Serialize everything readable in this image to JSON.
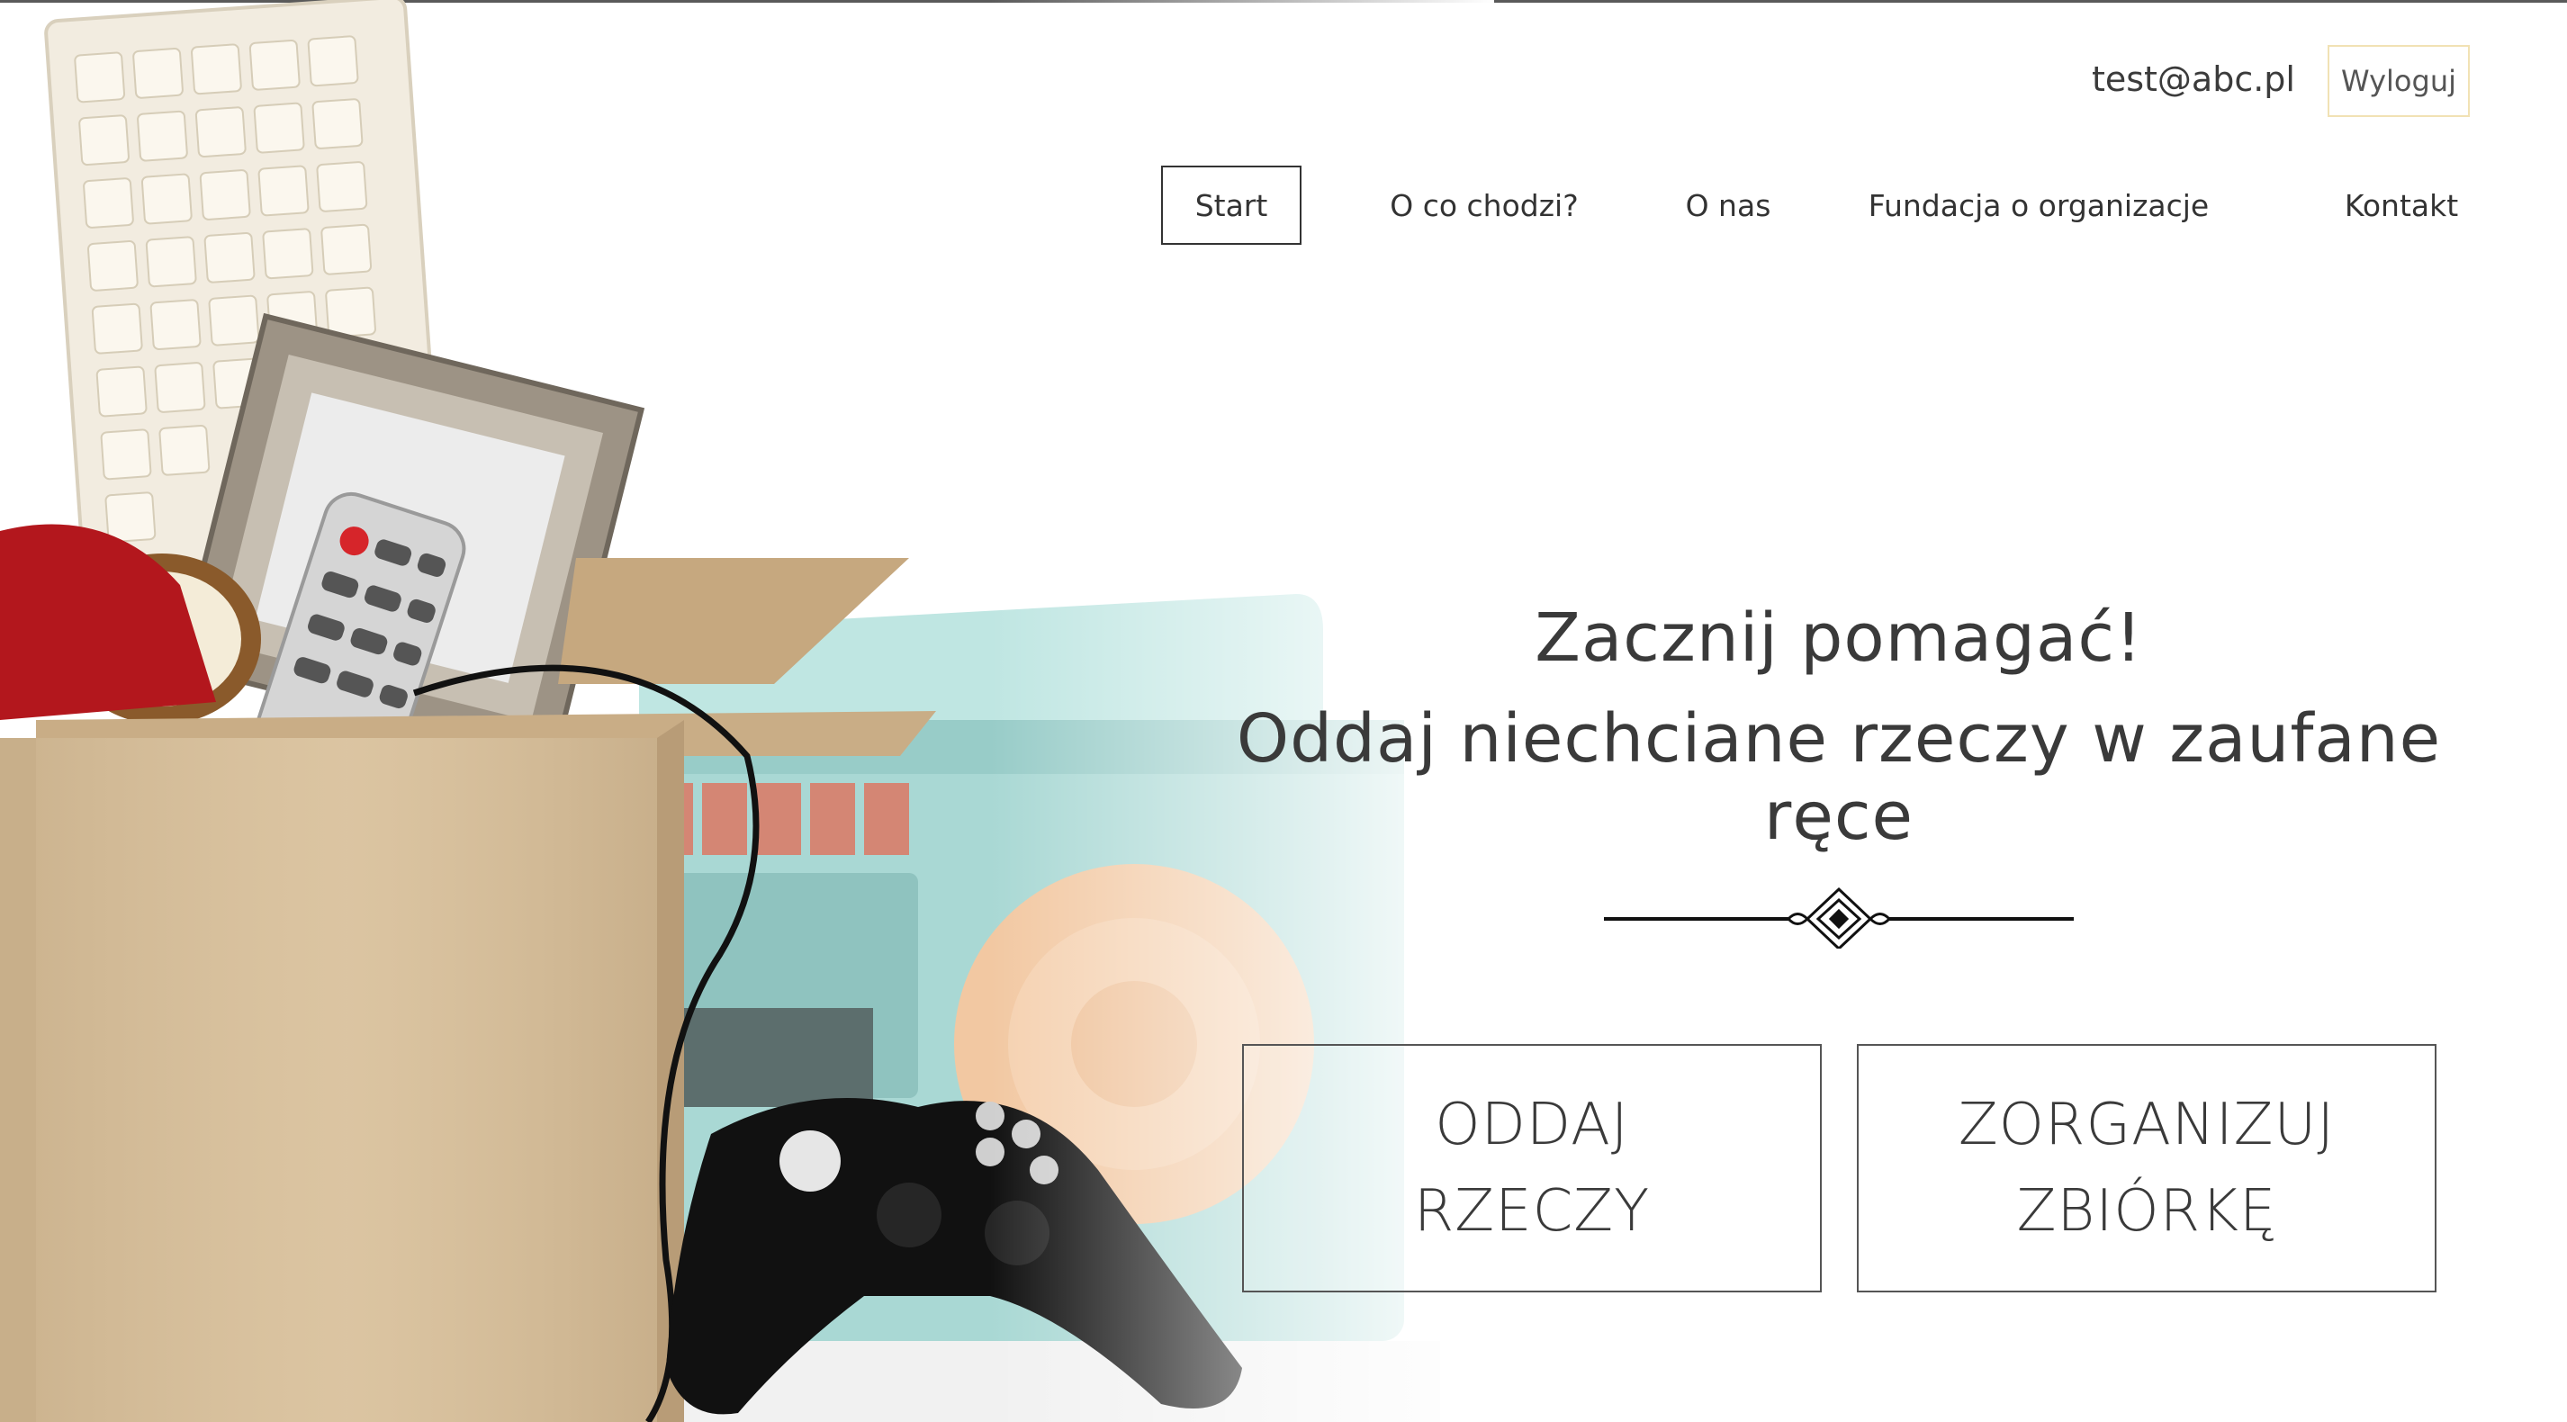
{
  "header": {
    "user_email": "test@abc.pl",
    "logout_label": "Wyloguj"
  },
  "nav": {
    "items": [
      {
        "label": "Start",
        "active": true
      },
      {
        "label": "O co chodzi?"
      },
      {
        "label": "O nas"
      },
      {
        "label": "Fundacja o organizacje"
      },
      {
        "label": "Kontakt"
      }
    ]
  },
  "hero": {
    "headline_line1": "Zacznij pomagać!",
    "headline_line2": "Oddaj niechciane rzeczy w zaufane ręce",
    "cta_give": {
      "line1": "ODDAJ",
      "line2": "RZECZY"
    },
    "cta_organize": {
      "line1": "ZORGANIZUJ",
      "line2": "ZBIÓRKĘ"
    }
  },
  "colors": {
    "text": "#3a3a3a",
    "logout_border": "#f1e2b4",
    "box_cardboard": "#d8c19e",
    "radio_teal": "#a9d8d4",
    "speaker_peach": "#f2c8a2"
  }
}
